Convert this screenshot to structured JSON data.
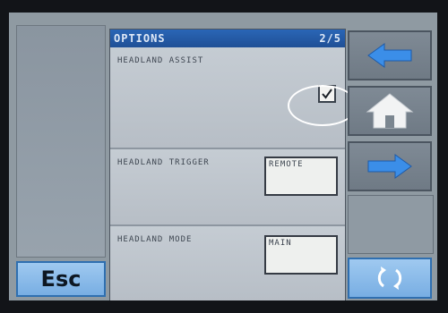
{
  "header": {
    "title": "OPTIONS",
    "page_indicator": "2/5"
  },
  "options": [
    {
      "label": "HEADLAND ASSIST",
      "type": "checkbox",
      "checked": true
    },
    {
      "label": "HEADLAND TRIGGER",
      "type": "selector",
      "value": "REMOTE"
    },
    {
      "label": "HEADLAND MODE",
      "type": "selector",
      "value": "MAIN"
    }
  ],
  "buttons": {
    "esc_label": "Esc",
    "back_icon": "arrow-left-icon",
    "home_icon": "home-icon",
    "forward_icon": "arrow-right-icon",
    "refresh_icon": "refresh-icon"
  },
  "colors": {
    "title_bar": "#1f4f96",
    "accent_blue": "#3b8ee8",
    "esc_button": "#78aee3",
    "highlight_ring": "#ffffff"
  }
}
